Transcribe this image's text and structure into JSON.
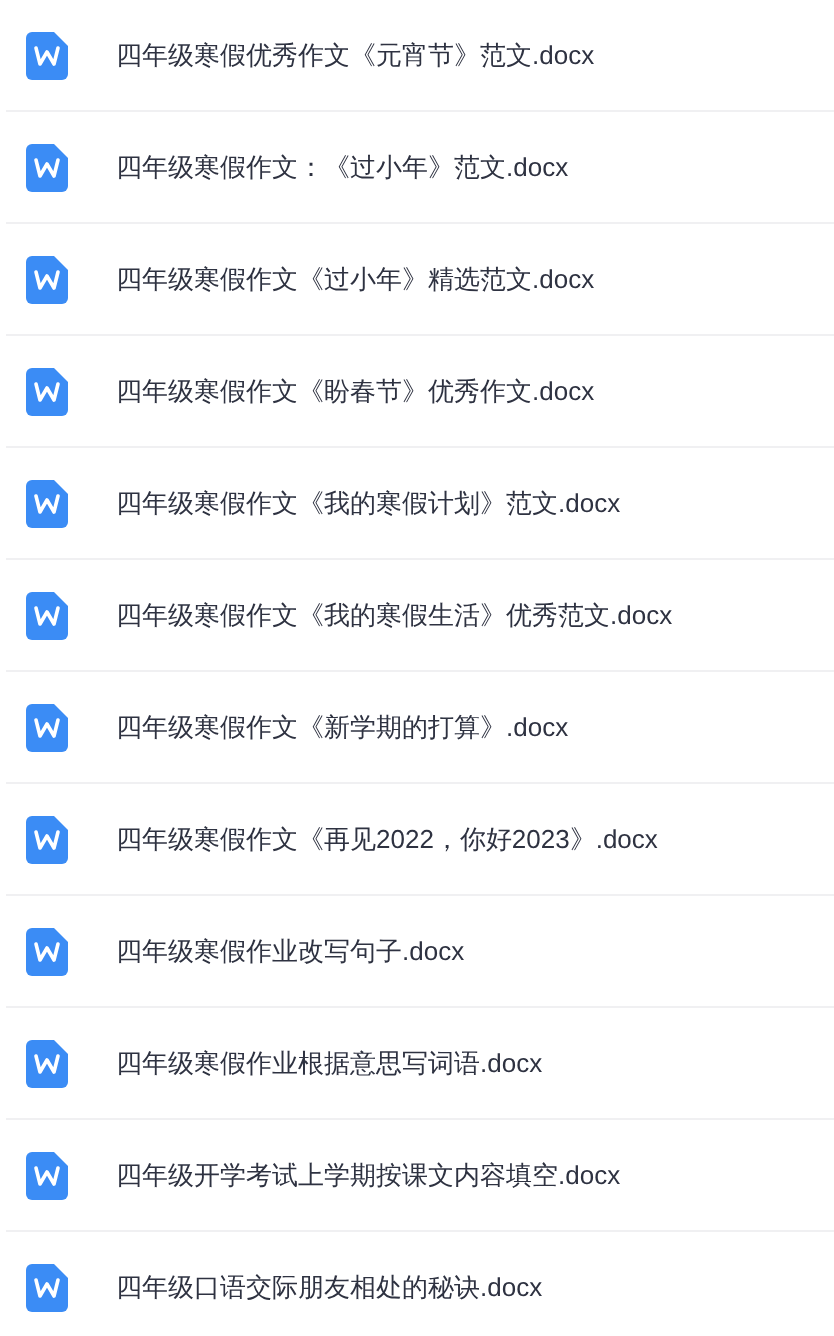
{
  "files": [
    {
      "name": "四年级寒假优秀作文《元宵节》范文.docx"
    },
    {
      "name": "四年级寒假作文：《过小年》范文.docx"
    },
    {
      "name": "四年级寒假作文《过小年》精选范文.docx"
    },
    {
      "name": "四年级寒假作文《盼春节》优秀作文.docx"
    },
    {
      "name": "四年级寒假作文《我的寒假计划》范文.docx"
    },
    {
      "name": "四年级寒假作文《我的寒假生活》优秀范文.docx"
    },
    {
      "name": "四年级寒假作文《新学期的打算》.docx"
    },
    {
      "name": "四年级寒假作文《再见2022，你好2023》.docx"
    },
    {
      "name": "四年级寒假作业改写句子.docx"
    },
    {
      "name": "四年级寒假作业根据意思写词语.docx"
    },
    {
      "name": "四年级开学考试上学期按课文内容填空.docx"
    },
    {
      "name": "四年级口语交际朋友相处的秘诀.docx"
    }
  ]
}
